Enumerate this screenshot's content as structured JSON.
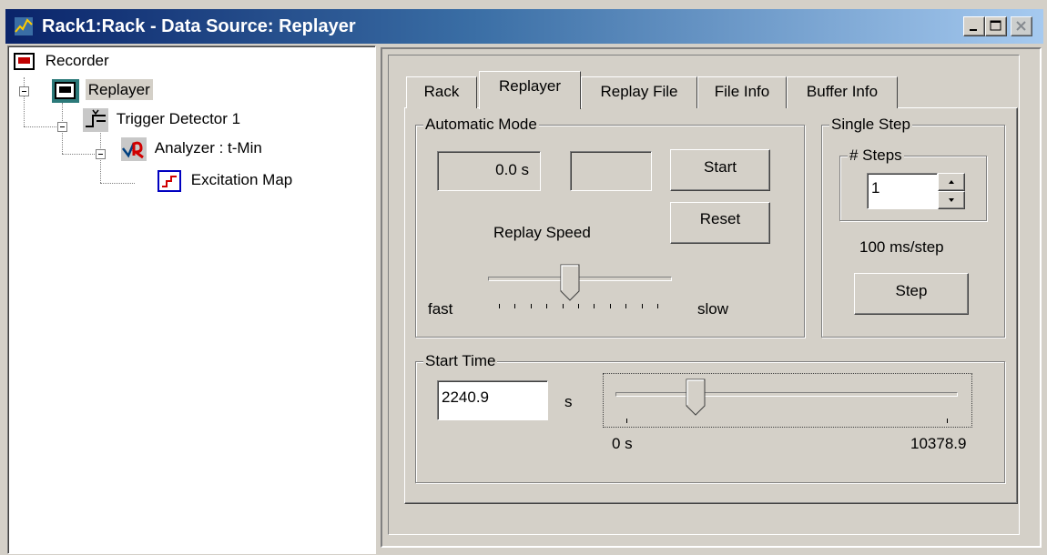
{
  "window": {
    "title": "Rack1:Rack - Data Source: Replayer"
  },
  "tree": {
    "items": [
      {
        "label": "Recorder",
        "icon": "recorder-icon"
      },
      {
        "label": "Replayer",
        "icon": "replayer-icon",
        "selected": true
      },
      {
        "label": "Trigger Detector 1",
        "icon": "trigger-icon"
      },
      {
        "label": "Analyzer : t-Min",
        "icon": "analyzer-icon"
      },
      {
        "label": "Excitation Map",
        "icon": "map-icon"
      }
    ]
  },
  "tabs": [
    {
      "label": "Rack"
    },
    {
      "label": "Replayer",
      "active": true
    },
    {
      "label": "Replay File"
    },
    {
      "label": "File Info"
    },
    {
      "label": "Buffer Info"
    }
  ],
  "automatic_mode": {
    "title": "Automatic Mode",
    "time_display": "0.0 s",
    "blank_display": "",
    "start_label": "Start",
    "reset_label": "Reset",
    "speed_label": "Replay Speed",
    "fast_label": "fast",
    "slow_label": "slow",
    "speed_position_fraction": 0.45
  },
  "single_step": {
    "title": "Single Step",
    "steps_title": "# Steps",
    "steps_value": "1",
    "rate_text": "100 ms/step",
    "step_label": "Step"
  },
  "start_time": {
    "title": "Start Time",
    "value": "2240.9",
    "unit": "s",
    "min_label": "0 s",
    "max_label": "10378.9",
    "min_value": 0,
    "max_value": 10378.9,
    "current_value": 2240.9
  }
}
